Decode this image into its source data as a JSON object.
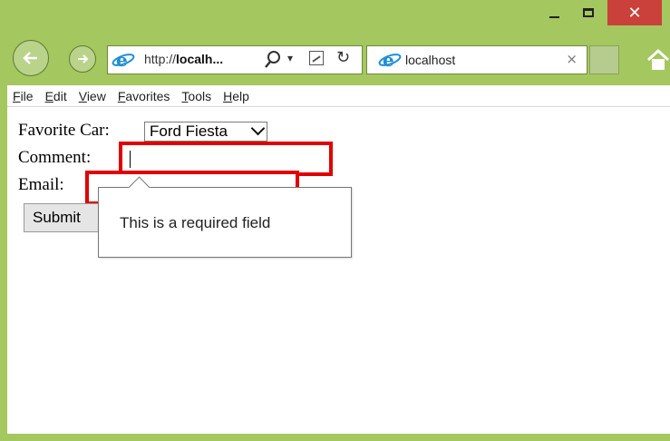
{
  "window": {
    "minimize_glyph": "",
    "close_glyph": "✕"
  },
  "nav": {
    "address_prefix": "http://",
    "address_host": "localh...",
    "search_glyph": "⚲",
    "dropdown_glyph": "▾",
    "refresh_glyph": "↻"
  },
  "tab": {
    "title": "localhost",
    "close_glyph": "×"
  },
  "menu": {
    "items": [
      "File",
      "Edit",
      "View",
      "Favorites",
      "Tools",
      "Help"
    ]
  },
  "form": {
    "car_label": "Favorite Car:",
    "car_selected": "Ford Fiesta",
    "comment_label": "Comment:",
    "comment_value": "",
    "email_label": "Email:",
    "email_value": "",
    "submit_label": "Submit"
  },
  "tooltip": {
    "message": "This is a required field"
  },
  "colors": {
    "frame": "#a4c75f",
    "close_button": "#c9413a",
    "invalid_border": "#e00000",
    "ie_logo": "#1e8fd6"
  },
  "icons": [
    "back-arrow-icon",
    "forward-arrow-icon",
    "ie-logo-icon",
    "search-icon",
    "compat-view-icon",
    "refresh-icon",
    "home-icon"
  ]
}
